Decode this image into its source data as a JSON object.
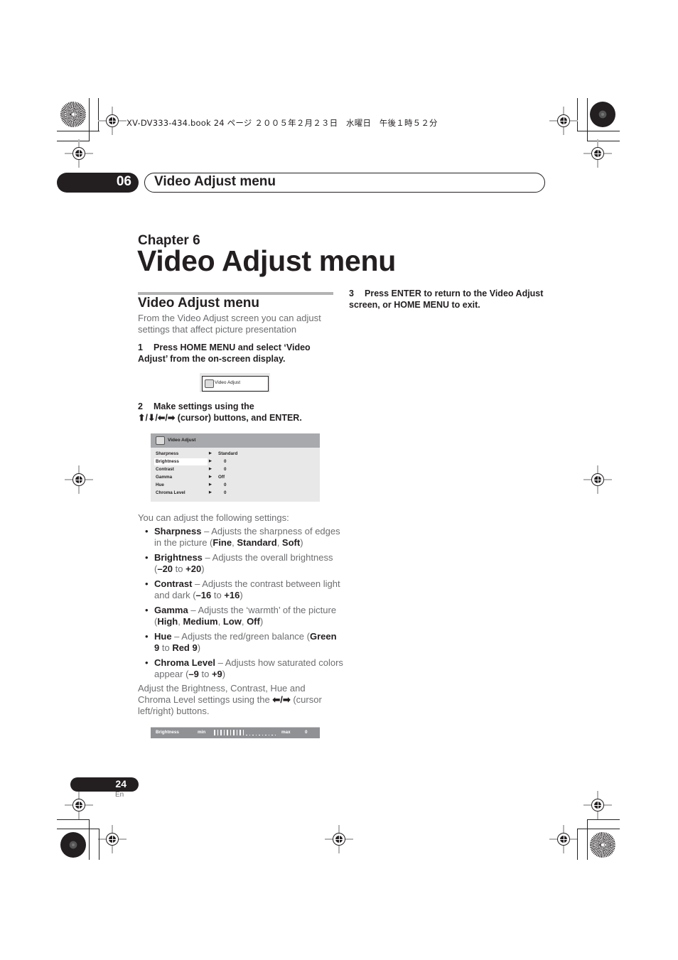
{
  "print_header": "XV-DV333-434.book  24 ページ  ２００５年２月２３日　水曜日　午後１時５２分",
  "chapter_tab": {
    "number": "06",
    "title": "Video Adjust menu"
  },
  "chapter": {
    "label": "Chapter 6",
    "title": "Video Adjust menu"
  },
  "section": {
    "title": "Video Adjust menu",
    "intro": "From the Video Adjust screen you can adjust settings that affect picture presentation"
  },
  "steps": [
    {
      "num": "1",
      "text": "Press HOME MENU and select ‘Video Adjust’ from the on-screen display."
    },
    {
      "num": "2",
      "text_line1": "Make settings using the",
      "text_line2": "⬆/⬇/⬅/➡ (cursor) buttons, and ENTER."
    },
    {
      "num": "3",
      "text": "Press ENTER to return to the Video Adjust screen, or HOME MENU to exit."
    }
  ],
  "osd_menu_item": {
    "icon": "video-adjust-icon",
    "label": "Video Adjust"
  },
  "osd_panel": {
    "title": "Video Adjust",
    "rows": [
      {
        "name": "Sharpness",
        "value": "Standard",
        "selected": false
      },
      {
        "name": "Brightness",
        "value": "0",
        "selected": true
      },
      {
        "name": "Contrast",
        "value": "0",
        "selected": false
      },
      {
        "name": "Gamma",
        "value": "Off",
        "selected": false
      },
      {
        "name": "Hue",
        "value": "0",
        "selected": false
      },
      {
        "name": "Chroma Level",
        "value": "0",
        "selected": false
      }
    ]
  },
  "settings_intro": "You can adjust the following settings:",
  "settings": [
    {
      "name": "Sharpness",
      "desc": " – Adjusts the sharpness of edges in the picture (",
      "options": [
        "Fine",
        "Standard",
        "Soft"
      ],
      "sep": ", ",
      "end": ")"
    },
    {
      "name": "Brightness",
      "desc": " – Adjusts the overall brightness (",
      "options": [
        "–20",
        "+20"
      ],
      "sep": " to ",
      "end": ")"
    },
    {
      "name": "Contrast",
      "desc": " – Adjusts the contrast between light and dark (",
      "options": [
        "–16",
        "+16"
      ],
      "sep": " to ",
      "end": ")"
    },
    {
      "name": "Gamma",
      "desc": " – Adjusts the ‘warmth’ of the picture (",
      "options": [
        "High",
        "Medium",
        "Low",
        "Off"
      ],
      "sep": ", ",
      "end": ")"
    },
    {
      "name": "Hue",
      "desc": " – Adjusts the red/green balance (",
      "options": [
        "Green 9",
        "Red 9"
      ],
      "sep": " to ",
      "end": ")"
    },
    {
      "name": "Chroma Level",
      "desc": " – Adjusts how saturated colors appear (",
      "options": [
        "–9",
        "+9"
      ],
      "sep": " to ",
      "end": ")"
    }
  ],
  "adjust_note_pre": "Adjust the Brightness, Contrast, Hue and Chroma Level settings using the ",
  "adjust_note_arrows": "⬅/➡",
  "adjust_note_post": " (cursor left/right) buttons.",
  "osd_slider": {
    "label": "Brightness",
    "min_label": "min",
    "max_label": "max",
    "value": "0",
    "level_fraction": 0.5,
    "total_steps": 20
  },
  "page": {
    "number": "24",
    "lang": "En"
  }
}
